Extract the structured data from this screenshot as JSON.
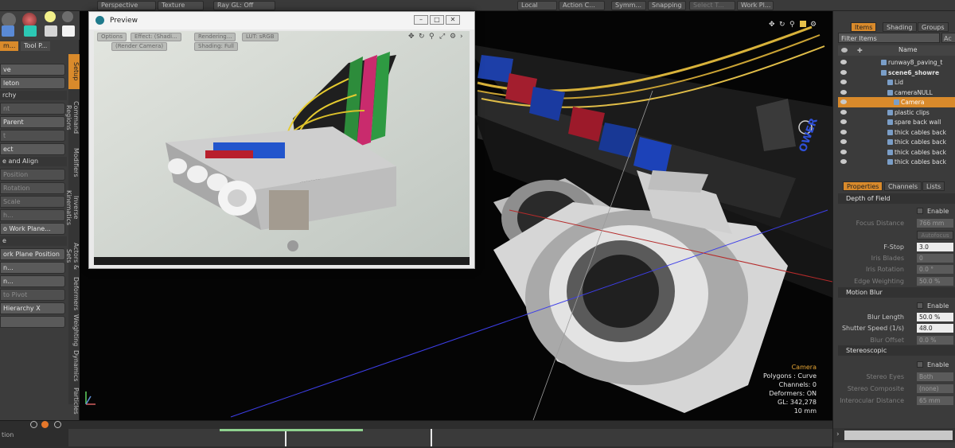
{
  "topbar": {
    "items": [
      "Perspective",
      "Texture",
      "Ray GL: Off",
      "Local",
      "Action C...",
      "Symm...",
      "Snapping",
      "Select T...",
      "Work Pl..."
    ]
  },
  "left": {
    "tabs": [
      "m...",
      "Tool P..."
    ],
    "buttons": [
      {
        "label": "ve",
        "dim": false
      },
      {
        "label": "leton",
        "dim": false
      },
      {
        "label": "rchy",
        "dim": false,
        "head": true
      },
      {
        "label": "nt",
        "dim": true
      },
      {
        "label": "Parent",
        "dim": false
      },
      {
        "label": "t",
        "dim": true
      },
      {
        "label": "ect",
        "dim": false
      },
      {
        "label": "e and Align",
        "dim": false,
        "head": true
      },
      {
        "label": "Position",
        "dim": true
      },
      {
        "label": "Rotation",
        "dim": true
      },
      {
        "label": "Scale",
        "dim": true
      },
      {
        "label": "h...",
        "dim": true
      },
      {
        "label": "o Work Plane...",
        "dim": false
      },
      {
        "label": "e",
        "dim": false,
        "head": true
      },
      {
        "label": "ork Plane Position",
        "dim": false
      },
      {
        "label": "n...",
        "dim": false
      },
      {
        "label": "n...",
        "dim": false
      },
      {
        "label": "to Pivot",
        "dim": true
      },
      {
        "label": "Hierarchy X",
        "dim": false
      },
      {
        "label": "",
        "dim": false
      }
    ],
    "vertical_tabs": [
      "Setup",
      "Command Regions",
      "Modifiers",
      "Inverse Kinematics",
      "Actors & Sets",
      "Deformers",
      "Weighting",
      "Dynamics",
      "Particles"
    ]
  },
  "preview": {
    "title": "Preview",
    "controls": [
      "–",
      "□",
      "✕"
    ],
    "buttons": [
      "Options",
      "Effect: (Shadi...",
      "Rendering...",
      "LUT: sRGB",
      "(Render Camera)",
      "Shading: Full"
    ]
  },
  "viewport": {
    "info": {
      "camera": "Camera",
      "polygons": "Polygons : Curve",
      "channels": "Channels: 0",
      "deformers": "Deformers: ON",
      "gl": "GL: 342,278",
      "unit": "10 mm"
    },
    "overlay_text": "OWER"
  },
  "right": {
    "tabs": [
      "Items",
      "Shading",
      "Groups"
    ],
    "filter_placeholder": "Filter Items",
    "filter_button": "Ac",
    "column_name": "Name",
    "items": [
      {
        "label": "runway8_paving_t",
        "selected": false
      },
      {
        "label": "scene6_showre",
        "selected": false
      },
      {
        "label": "Lid",
        "selected": false
      },
      {
        "label": "cameraNULL",
        "selected": false
      },
      {
        "label": "Camera",
        "selected": true
      },
      {
        "label": "plastic clips",
        "selected": false
      },
      {
        "label": "spare back wall",
        "selected": false
      },
      {
        "label": "thick cables back",
        "selected": false
      },
      {
        "label": "thick cables back",
        "selected": false
      },
      {
        "label": "thick cables back",
        "selected": false
      },
      {
        "label": "thick cables back",
        "selected": false
      }
    ],
    "prop_tabs": [
      "Properties",
      "Channels",
      "Lists"
    ],
    "dof": {
      "header": "Depth of Field",
      "enable": "Enable",
      "focus_distance_label": "Focus Distance",
      "focus_distance_value": "766 mm",
      "autofocus": "Autofocus",
      "fstop_label": "F-Stop",
      "fstop_value": "3.0",
      "iris_blades_label": "Iris Blades",
      "iris_blades_value": "0",
      "iris_rotation_label": "Iris Rotation",
      "iris_rotation_value": "0.0 °",
      "edge_weighting_label": "Edge Weighting",
      "edge_weighting_value": "50.0 %"
    },
    "motion_blur": {
      "header": "Motion Blur",
      "enable": "Enable",
      "blur_length_label": "Blur Length",
      "blur_length_value": "50.0 %",
      "shutter_speed_label": "Shutter Speed (1/s)",
      "shutter_speed_value": "48.0",
      "blur_offset_label": "Blur Offset",
      "blur_offset_value": "0.0 %"
    },
    "stereo": {
      "header": "Stereoscopic",
      "enable": "Enable",
      "eyes_label": "Stereo Eyes",
      "eyes_value": "Both",
      "composite_label": "Stereo Composite",
      "composite_value": "(none)",
      "interocular_label": "Interocular Distance",
      "interocular_value": "65 mm"
    }
  },
  "timeline": {
    "label1": "",
    "label2": "tion"
  }
}
